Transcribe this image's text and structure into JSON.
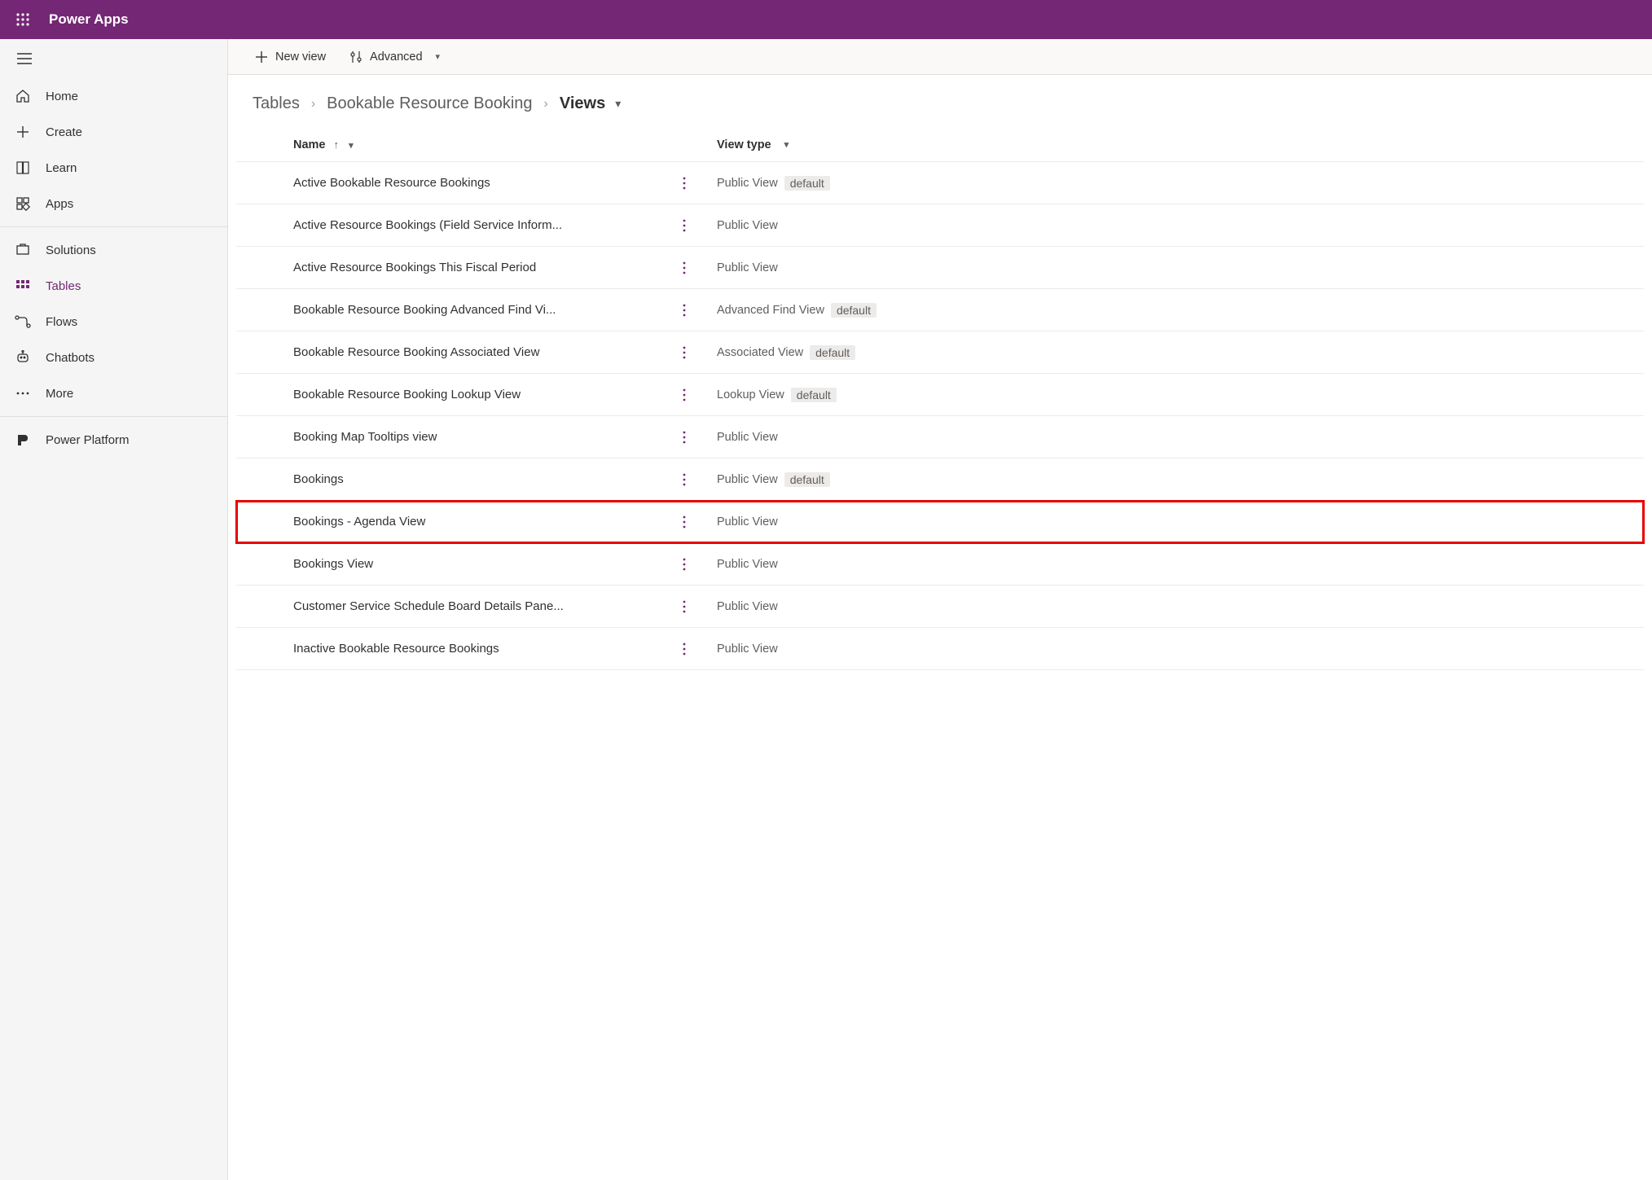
{
  "header": {
    "app_title": "Power Apps"
  },
  "sidebar": {
    "items": [
      {
        "icon": "home-icon",
        "label": "Home"
      },
      {
        "icon": "plus-icon",
        "label": "Create"
      },
      {
        "icon": "book-icon",
        "label": "Learn"
      },
      {
        "icon": "apps-icon",
        "label": "Apps"
      }
    ],
    "items2": [
      {
        "icon": "solutions-icon",
        "label": "Solutions"
      },
      {
        "icon": "tables-icon",
        "label": "Tables",
        "active": true
      },
      {
        "icon": "flows-icon",
        "label": "Flows"
      },
      {
        "icon": "chatbots-icon",
        "label": "Chatbots"
      },
      {
        "icon": "more-icon",
        "label": "More"
      }
    ],
    "items3": [
      {
        "icon": "powerplatform-icon",
        "label": "Power Platform"
      }
    ]
  },
  "cmdbar": {
    "new_view": "New view",
    "advanced": "Advanced"
  },
  "breadcrumb": {
    "b0": "Tables",
    "b1": "Bookable Resource Booking",
    "b2": "Views"
  },
  "table": {
    "headers": {
      "name": "Name",
      "type": "View type"
    },
    "default_badge": "default",
    "rows": [
      {
        "name": "Active Bookable Resource Bookings",
        "type": "Public View",
        "default": true
      },
      {
        "name": "Active Resource Bookings (Field Service Inform...",
        "type": "Public View",
        "default": false
      },
      {
        "name": "Active Resource Bookings This Fiscal Period",
        "type": "Public View",
        "default": false
      },
      {
        "name": "Bookable Resource Booking Advanced Find Vi...",
        "type": "Advanced Find View",
        "default": true
      },
      {
        "name": "Bookable Resource Booking Associated View",
        "type": "Associated View",
        "default": true
      },
      {
        "name": "Bookable Resource Booking Lookup View",
        "type": "Lookup View",
        "default": true
      },
      {
        "name": "Booking Map Tooltips view",
        "type": "Public View",
        "default": false
      },
      {
        "name": "Bookings",
        "type": "Public View",
        "default": true
      },
      {
        "name": "Bookings - Agenda View",
        "type": "Public View",
        "default": false,
        "highlight": true
      },
      {
        "name": "Bookings View",
        "type": "Public View",
        "default": false
      },
      {
        "name": "Customer Service Schedule Board Details Pane...",
        "type": "Public View",
        "default": false
      },
      {
        "name": "Inactive Bookable Resource Bookings",
        "type": "Public View",
        "default": false
      }
    ]
  }
}
